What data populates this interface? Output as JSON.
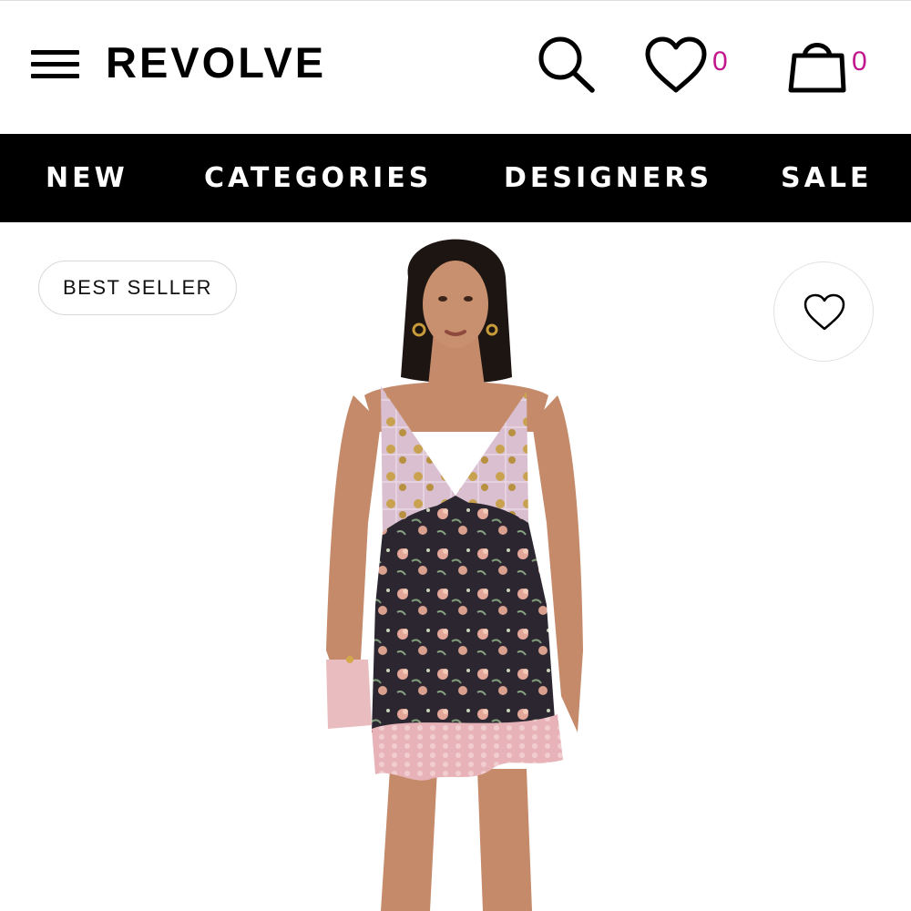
{
  "header": {
    "logo": "REVOLVE",
    "wishlist_count": "0",
    "bag_count": "0",
    "icons": [
      "menu-icon",
      "search-icon",
      "heart-icon",
      "shopping-bag-icon"
    ]
  },
  "nav": {
    "items": [
      {
        "label": "NEW"
      },
      {
        "label": "CATEGORIES"
      },
      {
        "label": "DESIGNERS"
      },
      {
        "label": "SALE"
      }
    ]
  },
  "product": {
    "badge": "BEST SELLER",
    "favorite_icon": "heart-outline-icon"
  },
  "colors": {
    "nav_background": "#000000",
    "nav_text": "#ffffff",
    "count_accent": "#c2168e"
  }
}
